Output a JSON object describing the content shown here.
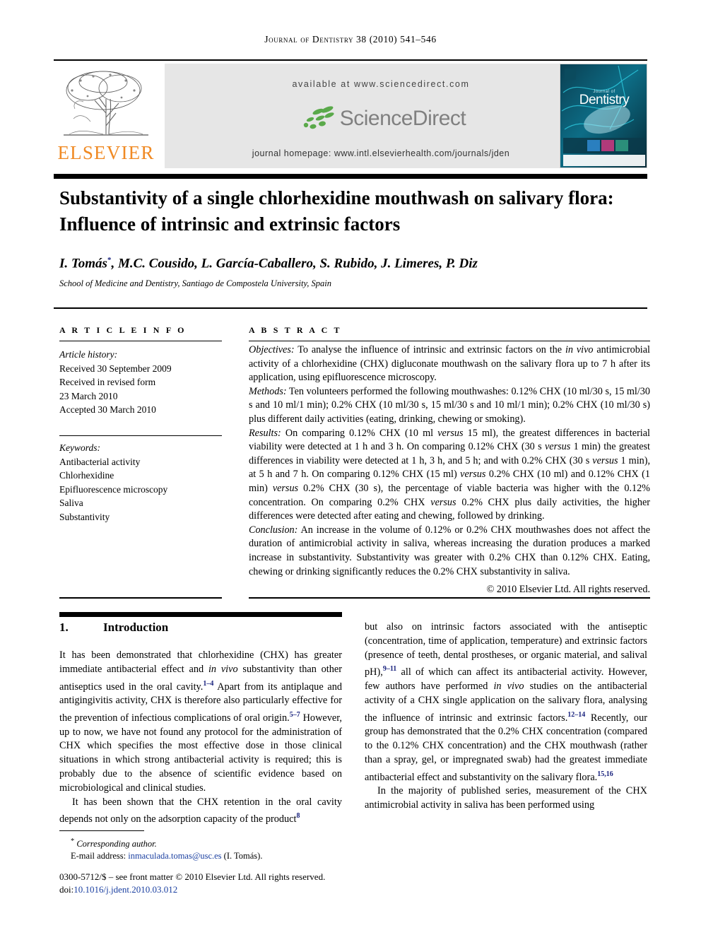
{
  "running_head": "Journal of Dentistry 38 (2010) 541–546",
  "masthead": {
    "publisher_name": "ELSEVIER",
    "publisher_logo_icon": "elsevier-tree-icon",
    "available_at": "available at www.sciencedirect.com",
    "sciencedirect_logo_text": "ScienceDirect",
    "sciencedirect_logo_icon": "sciencedirect-leaves-icon",
    "journal_homepage": "journal homepage: www.intl.elsevierhealth.com/journals/jden",
    "cover_thumbnail_icon": "journal-cover-thumbnail",
    "cover_title": "Dentistry",
    "cover_overline": "Journal of"
  },
  "article": {
    "title": "Substantivity of a single chlorhexidine mouthwash on salivary flora: Influence of intrinsic and extrinsic factors",
    "authors": "I. Tomás *, M.C. Cousido, L. García-Caballero, S. Rubido, J. Limeres, P. Diz",
    "affiliation": "School of Medicine and Dentistry, Santiago de Compostela University, Spain"
  },
  "article_info": {
    "heading": "A R T I C L E   I N F O",
    "history_label": "Article history:",
    "history": [
      "Received 30 September 2009",
      "Received in revised form",
      "23 March 2010",
      "Accepted 30 March 2010"
    ],
    "keywords_label": "Keywords:",
    "keywords": [
      "Antibacterial activity",
      "Chlorhexidine",
      "Epifluorescence microscopy",
      "Saliva",
      "Substantivity"
    ]
  },
  "abstract": {
    "heading": "A B S T R A C T",
    "objectives_label": "Objectives:",
    "objectives_text": " To analyse the influence of intrinsic and extrinsic factors on the ",
    "objectives_italic": "in vivo",
    "objectives_text2": " antimicrobial activity of a chlorhexidine (CHX) digluconate mouthwash on the salivary flora up to 7 h after its application, using epifluorescence microscopy.",
    "methods_label": "Methods:",
    "methods_text": " Ten volunteers performed the following mouthwashes: 0.12% CHX (10 ml/30 s, 15 ml/30 s and 10 ml/1 min); 0.2% CHX (10 ml/30 s, 15 ml/30 s and 10 ml/1 min); 0.2% CHX (10 ml/30 s) plus different daily activities (eating, drinking, chewing or smoking).",
    "results_label": "Results:",
    "results_text1": " On comparing 0.12% CHX (10 ml ",
    "results_it1": "versus",
    "results_text2": " 15 ml), the greatest differences in bacterial viability were detected at 1 h and 3 h. On comparing 0.12% CHX (30 s ",
    "results_it2": "versus",
    "results_text3": " 1 min) the greatest differences in viability were detected at 1 h, 3 h, and 5 h; and with 0.2% CHX (30 s ",
    "results_it3": "versus",
    "results_text4": " 1 min), at 5 h and 7 h. On comparing 0.12% CHX (15 ml) ",
    "results_it4": "versus",
    "results_text5": " 0.2% CHX (10 ml) and 0.12% CHX (1 min) ",
    "results_it5": "versus",
    "results_text6": " 0.2% CHX (30 s), the percentage of viable bacteria was higher with the 0.12% concentration. On comparing 0.2% CHX ",
    "results_it6": "versus",
    "results_text7": " 0.2% CHX plus daily activities, the higher differences were detected after eating and chewing, followed by drinking.",
    "conclusion_label": "Conclusion:",
    "conclusion_text": " An increase in the volume of 0.12% or 0.2% CHX mouthwashes does not affect the duration of antimicrobial activity in saliva, whereas increasing the duration produces a marked increase in substantivity. Substantivity was greater with 0.2% CHX than 0.12% CHX. Eating, chewing or drinking significantly reduces the 0.2% CHX substantivity in saliva.",
    "copyright": "© 2010 Elsevier Ltd. All rights reserved."
  },
  "introduction": {
    "number": "1.",
    "heading": "Introduction",
    "left_p1_a": "It has been demonstrated that chlorhexidine (CHX) has greater immediate antibacterial effect and ",
    "left_p1_it": "in vivo",
    "left_p1_b": " substantivity than other antiseptics used in the oral cavity.",
    "left_p1_ref1": "1–4",
    "left_p1_c": " Apart from its antiplaque and antigingivitis activity, CHX is therefore also particularly effective for the prevention of infectious complications of oral origin.",
    "left_p1_ref2": "5–7",
    "left_p1_d": " However, up to now, we have not found any protocol for the administration of CHX which specifies the most effective dose in those clinical situations in which strong antibacterial activity is required; this is probably due to the absence of scientific evidence based on microbiological and clinical studies.",
    "left_p2_a": "It has been shown that the CHX retention in the oral cavity depends not only on the adsorption capacity of the product",
    "left_p2_ref": "8",
    "right_p1_a": "but also on intrinsic factors associated with the antiseptic (concentration, time of application, temperature) and extrinsic factors (presence of teeth, dental prostheses, or organic material, and salival pH),",
    "right_p1_ref1": "9–11",
    "right_p1_b": " all of which can affect its antibacterial activity. However, few authors have performed ",
    "right_p1_it": "in vivo",
    "right_p1_c": " studies on the antibacterial activity of a CHX single application on the salivary flora, analysing the influence of intrinsic and extrinsic factors.",
    "right_p1_ref2": "12–14",
    "right_p1_d": " Recently, our group has demonstrated that the 0.2% CHX concentration (compared to the 0.12% CHX concentration) and the CHX mouthwash (rather than a spray, gel, or impregnated swab) had the greatest immediate antibacterial effect and substantivity on the salivary flora.",
    "right_p1_ref3": "15,16",
    "right_p2": "In the majority of published series, measurement of the CHX antimicrobial activity in saliva has been performed using"
  },
  "footer": {
    "corresponding_marker": "*",
    "corresponding_label": "Corresponding author.",
    "email_label": "E-mail address:",
    "email_address": "inmaculada.tomas@usc.es",
    "email_owner": "(I. Tomás).",
    "issn_line": "0300-5712/$ – see front matter © 2010 Elsevier Ltd. All rights reserved.",
    "doi_label": "doi:",
    "doi_value": "10.1016/j.jdent.2010.03.012"
  },
  "colors": {
    "elsevier_orange": "#f08a24",
    "sciencedirect_green": "#5aa94a",
    "sciencedirect_gray": "#808080",
    "link_blue": "#1a3fa0",
    "band_gray": "#e6e6e6",
    "cover_teal": "#0b5f73"
  }
}
